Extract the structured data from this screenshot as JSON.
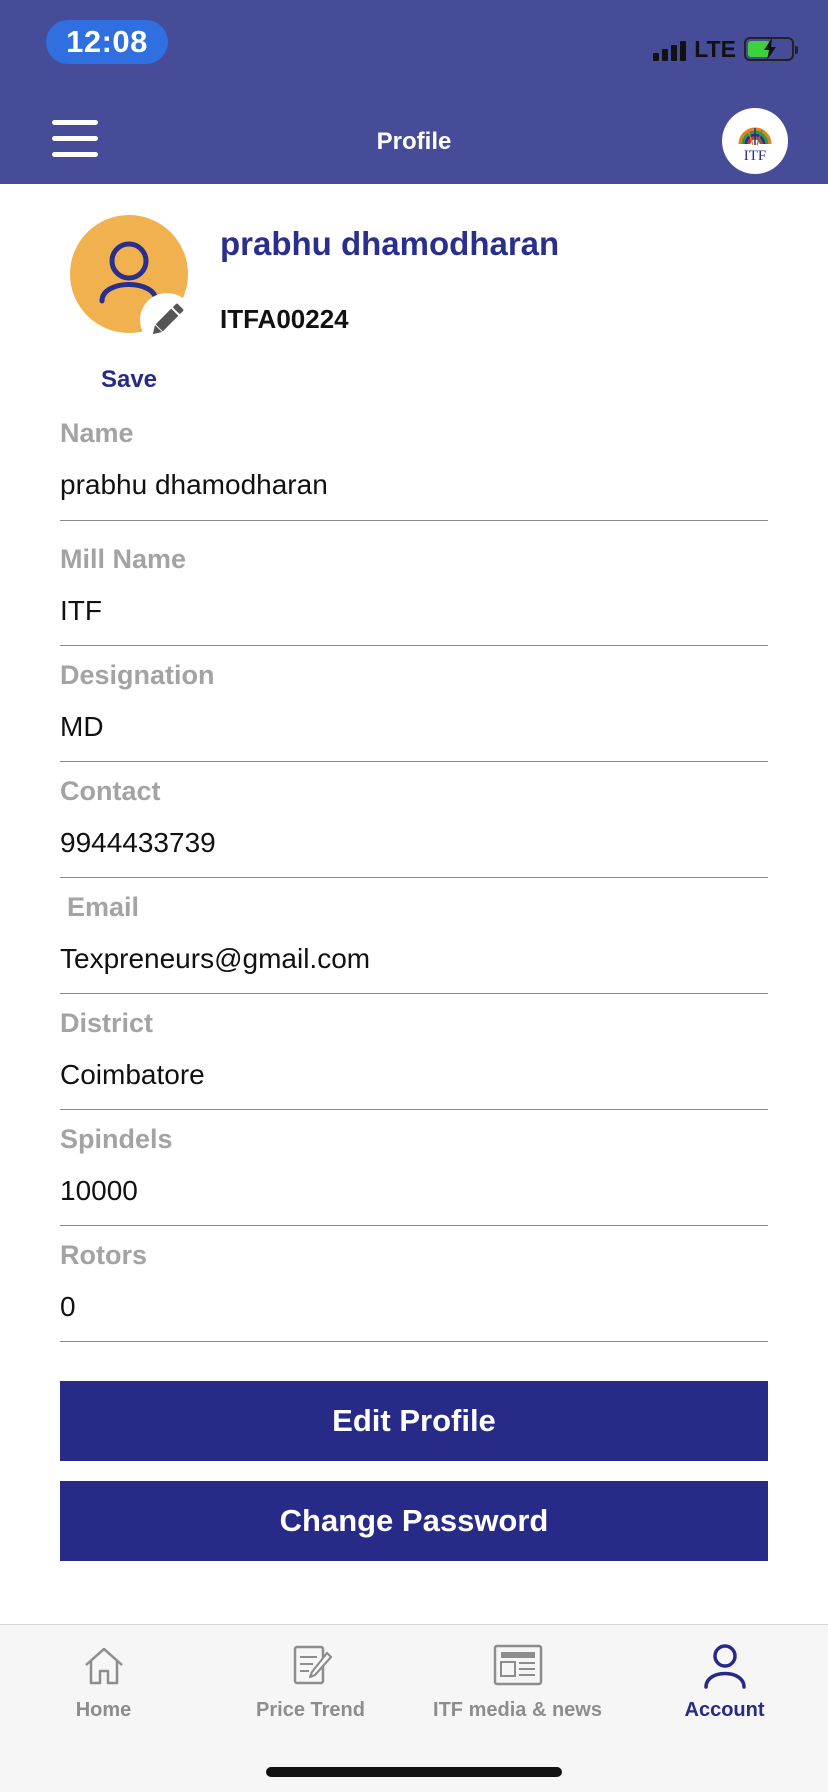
{
  "status_bar": {
    "time": "12:08",
    "network": "LTE"
  },
  "header": {
    "title": "Profile",
    "logo_text": "ITF"
  },
  "profile": {
    "name": "prabhu dhamodharan",
    "member_id": "ITFA00224",
    "save_label": "Save"
  },
  "fields": {
    "name": {
      "label": "Name",
      "value": "prabhu dhamodharan"
    },
    "mill_name": {
      "label": "Mill Name",
      "value": "ITF"
    },
    "designation": {
      "label": "Designation",
      "value": "MD"
    },
    "contact": {
      "label": "Contact",
      "value": "9944433739"
    },
    "email": {
      "label": "Email",
      "value": "Texpreneurs@gmail.com"
    },
    "district": {
      "label": "District",
      "value": "Coimbatore"
    },
    "spindels": {
      "label": "Spindels",
      "value": "10000"
    },
    "rotors": {
      "label": "Rotors",
      "value": "0"
    }
  },
  "buttons": {
    "edit_profile": "Edit Profile",
    "change_password": "Change Password"
  },
  "tabs": [
    {
      "label": "Home",
      "icon": "home-icon",
      "active": false
    },
    {
      "label": "Price Trend",
      "icon": "price-trend-icon",
      "active": false
    },
    {
      "label": "ITF media & news",
      "icon": "newspaper-icon",
      "active": false
    },
    {
      "label": "Account",
      "icon": "account-icon",
      "active": true
    }
  ],
  "colors": {
    "header": "#464c98",
    "accent": "#272a86",
    "avatar": "#f0b14e",
    "label": "#a3a3a3"
  }
}
